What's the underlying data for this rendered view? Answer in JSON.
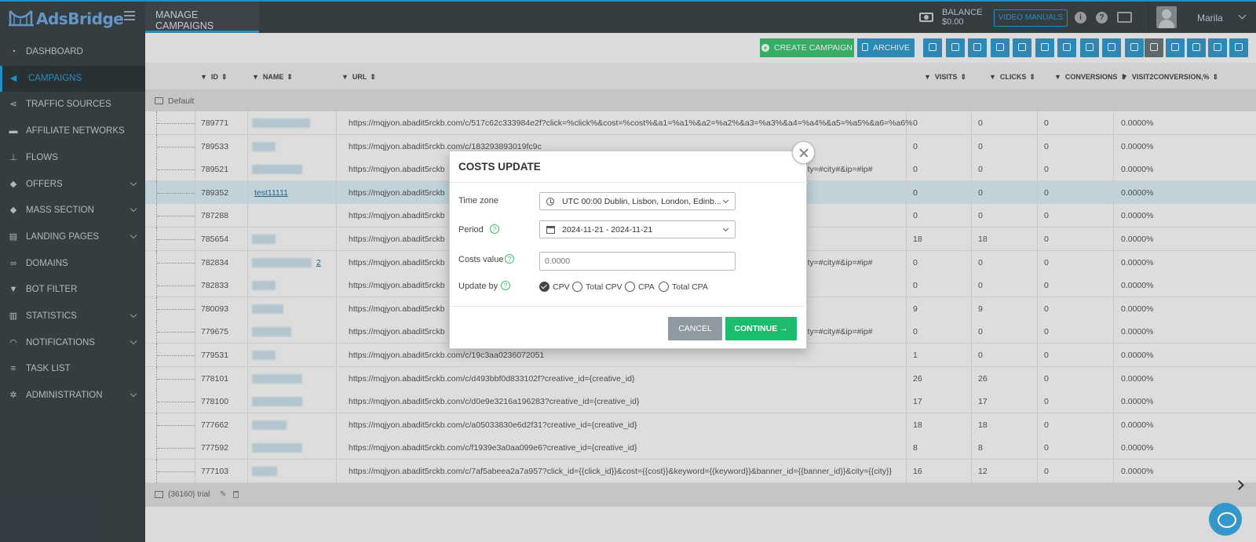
{
  "app": {
    "logo_text": "AdsBridge",
    "page_title": "MANAGE CAMPAIGNS"
  },
  "header": {
    "balance_label": "BALANCE",
    "balance_value": "$0.00",
    "video_manuals": "VIDEO MANUALS",
    "username": "Marila"
  },
  "sidebar": {
    "items": [
      {
        "label": "DASHBOARD",
        "icon": "dashboard-icon",
        "glyph": "◔",
        "chevron": false,
        "active": false
      },
      {
        "label": "CAMPAIGNS",
        "icon": "megaphone-icon",
        "glyph": "◀",
        "chevron": false,
        "active": true
      },
      {
        "label": "TRAFFIC SOURCES",
        "icon": "share-icon",
        "glyph": "⋖",
        "chevron": false,
        "active": false
      },
      {
        "label": "AFFILIATE NETWORKS",
        "icon": "briefcase-icon",
        "glyph": "▬",
        "chevron": false,
        "active": false
      },
      {
        "label": "FLOWS",
        "icon": "sitemap-icon",
        "glyph": "⊥",
        "chevron": false,
        "active": false
      },
      {
        "label": "OFFERS",
        "icon": "tag-icon",
        "glyph": "◆",
        "chevron": true,
        "active": false
      },
      {
        "label": "MASS SECTION",
        "icon": "tags-icon",
        "glyph": "◆",
        "chevron": true,
        "active": false
      },
      {
        "label": "LANDING PAGES",
        "icon": "layout-icon",
        "glyph": "▤",
        "chevron": true,
        "active": false
      },
      {
        "label": "DOMAINS",
        "icon": "link-icon",
        "glyph": "∞",
        "chevron": false,
        "active": false
      },
      {
        "label": "BOT FILTER",
        "icon": "filter-icon",
        "glyph": "▼",
        "chevron": false,
        "active": false
      },
      {
        "label": "STATISTICS",
        "icon": "bar-chart-icon",
        "glyph": "▥",
        "chevron": true,
        "active": false
      },
      {
        "label": "NOTIFICATIONS",
        "icon": "bell-icon",
        "glyph": "◠",
        "chevron": true,
        "active": false
      },
      {
        "label": "TASK LIST",
        "icon": "list-icon",
        "glyph": "≡",
        "chevron": false,
        "active": false
      },
      {
        "label": "ADMINISTRATION",
        "icon": "gear-icon",
        "glyph": "✲",
        "chevron": true,
        "active": false
      }
    ]
  },
  "toolbar": {
    "create_campaign": "CREATE CAMPAIGN",
    "archive": "ARCHIVE"
  },
  "table": {
    "columns": [
      "ID",
      "NAME",
      "URL",
      "VISITS",
      "CLICKS",
      "CONVERSIONS",
      "VISIT2CONVERSION,%"
    ],
    "group_label": "Default",
    "footer_label": "{36160} trial",
    "rows": [
      {
        "id": "789771",
        "name": "",
        "url": "https://mqjyon.abadit5rckb.com/c/517c62c333984e2f?click=%click%&cost=%cost%&a1=%a1%&a2=%a2%&a3=%a3%&a4=%a4%&a5=%a5%&a6=%a6%",
        "visits": "0",
        "clicks": "0",
        "conversions": "0",
        "v2c": "0.0000%"
      },
      {
        "id": "789533",
        "name": "",
        "url": "https://mqjyon.abadit5rckb.com/c/183293893019fc9c",
        "visits": "0",
        "clicks": "0",
        "conversions": "0",
        "v2c": "0.0000%"
      },
      {
        "id": "789521",
        "name": "",
        "url": "https://mqjyon.abadit5rckb",
        "url_tail": "&city=#city#&ip=#ip#",
        "visits": "0",
        "clicks": "0",
        "conversions": "0",
        "v2c": "0.0000%"
      },
      {
        "id": "789352",
        "name": "test11111",
        "url": "https://mqjyon.abadit5rckb",
        "visits": "0",
        "clicks": "0",
        "conversions": "0",
        "v2c": "0.0000%",
        "selected": true
      },
      {
        "id": "787288",
        "name": "",
        "url": "https://mqjyon.abadit5rckb",
        "visits": "0",
        "clicks": "0",
        "conversions": "0",
        "v2c": "0.0000%"
      },
      {
        "id": "785654",
        "name": "",
        "url": "https://mqjyon.abadit5rckb",
        "visits": "18",
        "clicks": "18",
        "conversions": "0",
        "v2c": "0.0000%"
      },
      {
        "id": "782834",
        "name": "2",
        "url": "https://mqjyon.abadit5rckb",
        "url_tail": "&city=#city#&ip=#ip#",
        "visits": "0",
        "clicks": "0",
        "conversions": "0",
        "v2c": "0.0000%"
      },
      {
        "id": "782833",
        "name": "",
        "url": "https://mqjyon.abadit5rckb",
        "visits": "0",
        "clicks": "0",
        "conversions": "0",
        "v2c": "0.0000%"
      },
      {
        "id": "780093",
        "name": "",
        "url": "https://mqjyon.abadit5rckb",
        "visits": "9",
        "clicks": "9",
        "conversions": "0",
        "v2c": "0.0000%"
      },
      {
        "id": "779675",
        "name": "",
        "url": "https://mqjyon.abadit5rckb",
        "url_tail": "&city=#city#&ip=#ip#",
        "visits": "0",
        "clicks": "0",
        "conversions": "0",
        "v2c": "0.0000%"
      },
      {
        "id": "779531",
        "name": "",
        "url": "https://mqjyon.abadit5rckb.com/c/19c3aa0236072051",
        "visits": "1",
        "clicks": "0",
        "conversions": "0",
        "v2c": "0.0000%"
      },
      {
        "id": "778101",
        "name": "",
        "url": "https://mqjyon.abadit5rckb.com/c/d493bbf0d833102f?creative_id={creative_id}",
        "visits": "26",
        "clicks": "26",
        "conversions": "0",
        "v2c": "0.0000%"
      },
      {
        "id": "778100",
        "name": "",
        "url": "https://mqjyon.abadit5rckb.com/c/d0e9e3216a196283?creative_id={creative_id}",
        "visits": "17",
        "clicks": "17",
        "conversions": "0",
        "v2c": "0.0000%"
      },
      {
        "id": "777662",
        "name": "",
        "url": "https://mqjyon.abadit5rckb.com/c/a05033830e6d2f31?creative_id={creative_id}",
        "visits": "18",
        "clicks": "18",
        "conversions": "0",
        "v2c": "0.0000%"
      },
      {
        "id": "777592",
        "name": "",
        "url": "https://mqjyon.abadit5rckb.com/c/f1939e3a0aa099e6?creative_id={creative_id}",
        "visits": "8",
        "clicks": "8",
        "conversions": "0",
        "v2c": "0.0000%"
      },
      {
        "id": "777103",
        "name": "",
        "url": "https://mqjyon.abadit5rckb.com/c/7af5abeea2a7a957?click_id={{click_id}}&cost={{cost}}&keyword={{keyword}}&banner_id={{banner_id}}&city={{city}}",
        "visits": "16",
        "clicks": "12",
        "conversions": "0",
        "v2c": "0.0000%"
      }
    ]
  },
  "modal": {
    "title": "COSTS UPDATE",
    "timezone_label": "Time zone",
    "timezone_value": "UTC 00:00 Dublin, Lisbon, London, Edinb...",
    "period_label": "Period",
    "period_value": "2024-11-21 - 2024-11-21",
    "costs_label": "Costs value",
    "costs_placeholder": "0.0000",
    "update_by_label": "Update by",
    "update_options": [
      {
        "label": "CPV",
        "checked": true
      },
      {
        "label": "Total CPV",
        "checked": false
      },
      {
        "label": "CPA",
        "checked": false
      },
      {
        "label": "Total CPA",
        "checked": false
      }
    ],
    "cancel": "CANCEL",
    "continue": "CONTINUE →"
  },
  "colors": {
    "accent": "#2a9fd6",
    "success": "#1cbc6f",
    "sidebar_bg": "#3b4449"
  }
}
